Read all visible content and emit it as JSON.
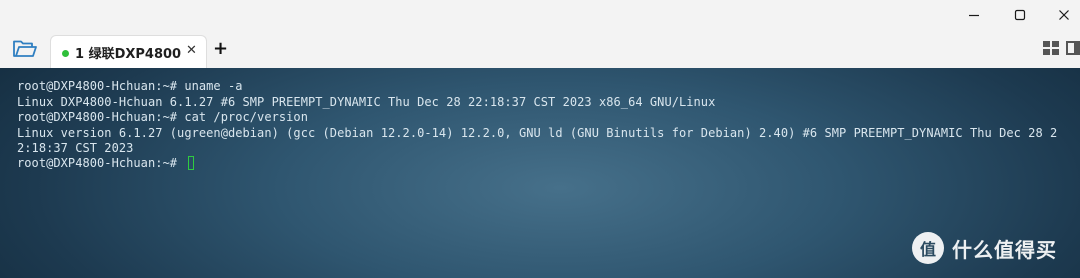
{
  "window": {
    "controls": [
      "minimize-icon",
      "maximize-icon",
      "close-icon"
    ]
  },
  "tabs": [
    {
      "label": "1 绿联DXP4800",
      "status_color": "#2fbf3a",
      "active": true
    }
  ],
  "tabbar": {
    "new_tab_label": "+",
    "close_tab_label": "✕",
    "left_icon": "folder-open-icon",
    "right_icons": [
      "layout-grid-icon",
      "side-panel-icon"
    ]
  },
  "terminal": {
    "lines": [
      "root@DXP4800-Hchuan:~# uname -a",
      "Linux DXP4800-Hchuan 6.1.27 #6 SMP PREEMPT_DYNAMIC Thu Dec 28 22:18:37 CST 2023 x86_64 GNU/Linux",
      "root@DXP4800-Hchuan:~# cat /proc/version",
      "Linux version 6.1.27 (ugreen@debian) (gcc (Debian 12.2.0-14) 12.2.0, GNU ld (GNU Binutils for Debian) 2.40) #6 SMP PREEMPT_DYNAMIC Thu Dec 28 2",
      "2:18:37 CST 2023",
      "root@DXP4800-Hchuan:~# "
    ],
    "cursor_color": "#2ecc40"
  },
  "watermark": {
    "logo_char": "值",
    "text": "什么值得买"
  }
}
